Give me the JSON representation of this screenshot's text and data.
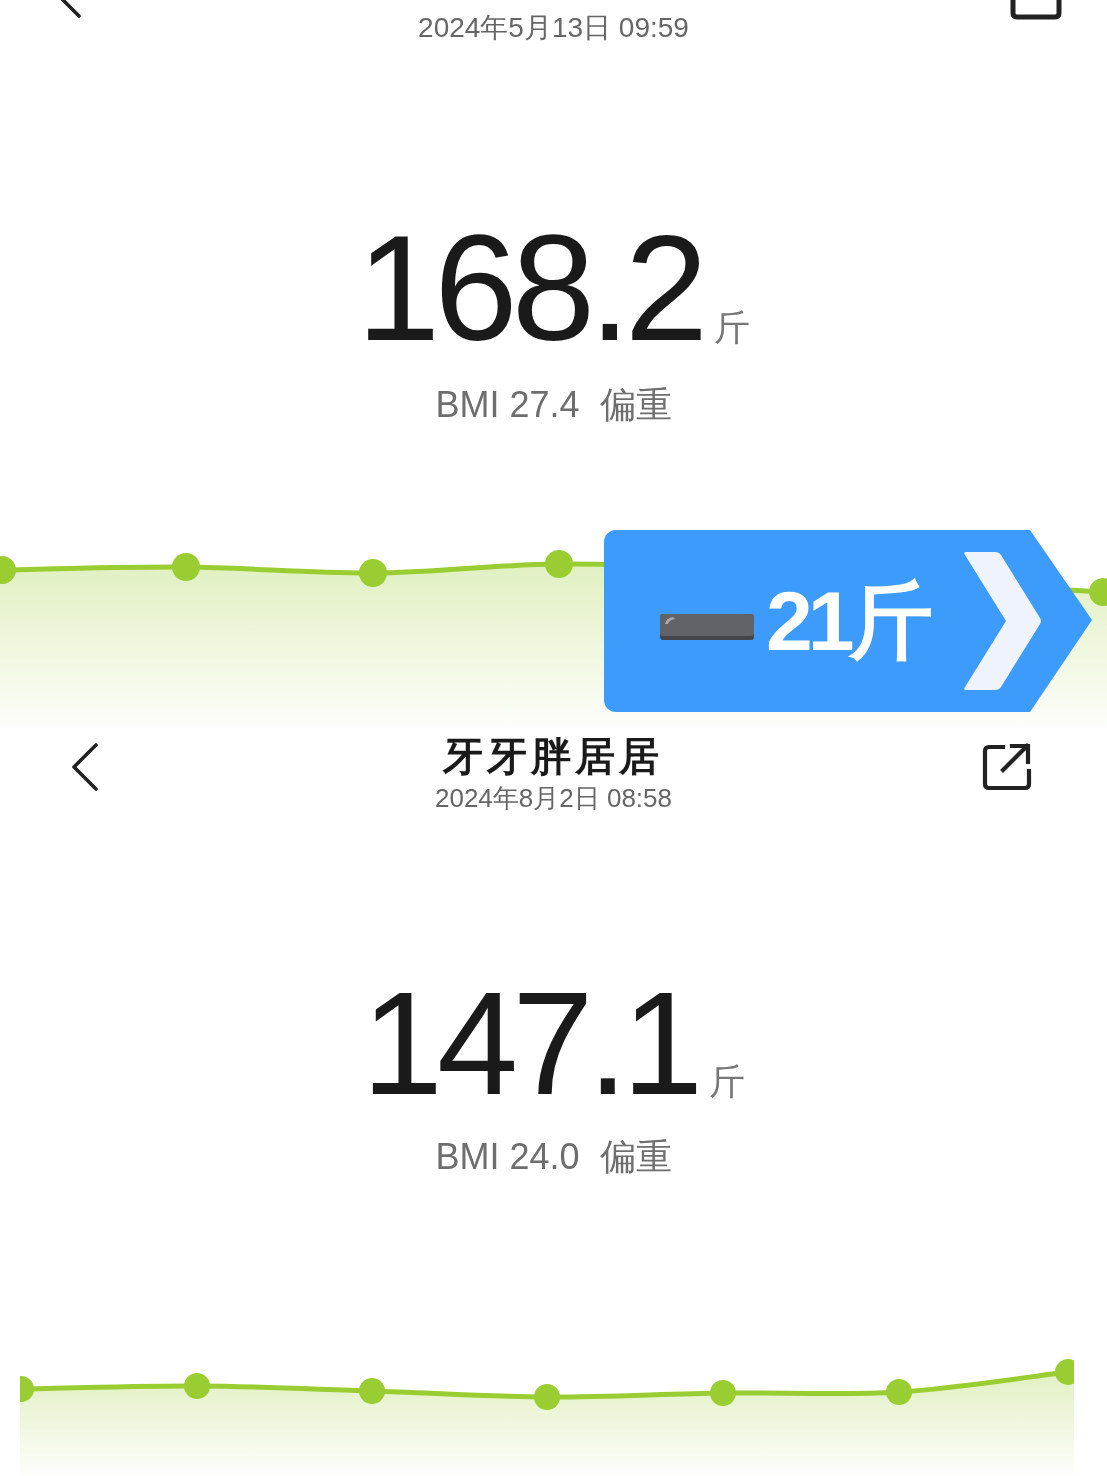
{
  "screens": [
    {
      "header_cropped": true,
      "date": "2024年5月13日 09:59",
      "weight": "168.2",
      "unit": "斤",
      "bmi": "BMI 27.4",
      "bmi_status": "偏重",
      "trend_graph": {
        "kind": "line"
      }
    },
    {
      "header_cropped": false,
      "title": "牙牙胖居居",
      "date": "2024年8月2日 08:58",
      "weight": "147.1",
      "unit": "斤",
      "bmi": "BMI 24.0",
      "bmi_status": "偏重",
      "trend_graph": {
        "kind": "line"
      }
    }
  ],
  "change_badge": {
    "decrease": true,
    "amount": "21斤"
  }
}
